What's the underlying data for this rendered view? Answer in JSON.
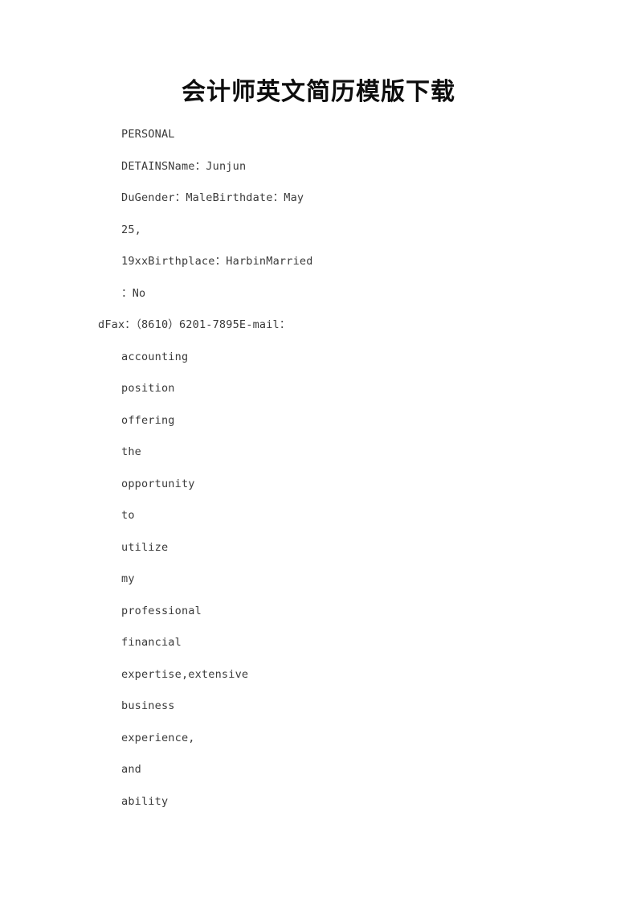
{
  "document": {
    "title": "会计师英文简历模版下载",
    "page_background": "#ffffff",
    "text_color": "#3a3a3a",
    "title_color": "#0d0d0d",
    "lines": [
      {
        "text": "PERSONAL",
        "indent": "main"
      },
      {
        "text": "DETAINSName：Junjun",
        "indent": "main"
      },
      {
        "text": "DuGender：MaleBirthdate：May",
        "indent": "main"
      },
      {
        "text": "25,",
        "indent": "main"
      },
      {
        "text": "19xxBirthplace：HarbinMarried",
        "indent": "main"
      },
      {
        "text": "：No",
        "indent": "main"
      },
      {
        "text": "dFax：（8610）6201-7895E-mail：",
        "indent": "hang"
      },
      {
        "text": "accounting",
        "indent": "main"
      },
      {
        "text": "position",
        "indent": "main"
      },
      {
        "text": "offering",
        "indent": "main"
      },
      {
        "text": "the",
        "indent": "main"
      },
      {
        "text": "opportunity",
        "indent": "main"
      },
      {
        "text": "to",
        "indent": "main"
      },
      {
        "text": "utilize",
        "indent": "main"
      },
      {
        "text": "my",
        "indent": "main"
      },
      {
        "text": "professional",
        "indent": "main"
      },
      {
        "text": "financial",
        "indent": "main"
      },
      {
        "text": "expertise,extensive",
        "indent": "main"
      },
      {
        "text": "business",
        "indent": "main"
      },
      {
        "text": "experience,",
        "indent": "main"
      },
      {
        "text": "and",
        "indent": "main"
      },
      {
        "text": "ability",
        "indent": "main"
      }
    ]
  }
}
